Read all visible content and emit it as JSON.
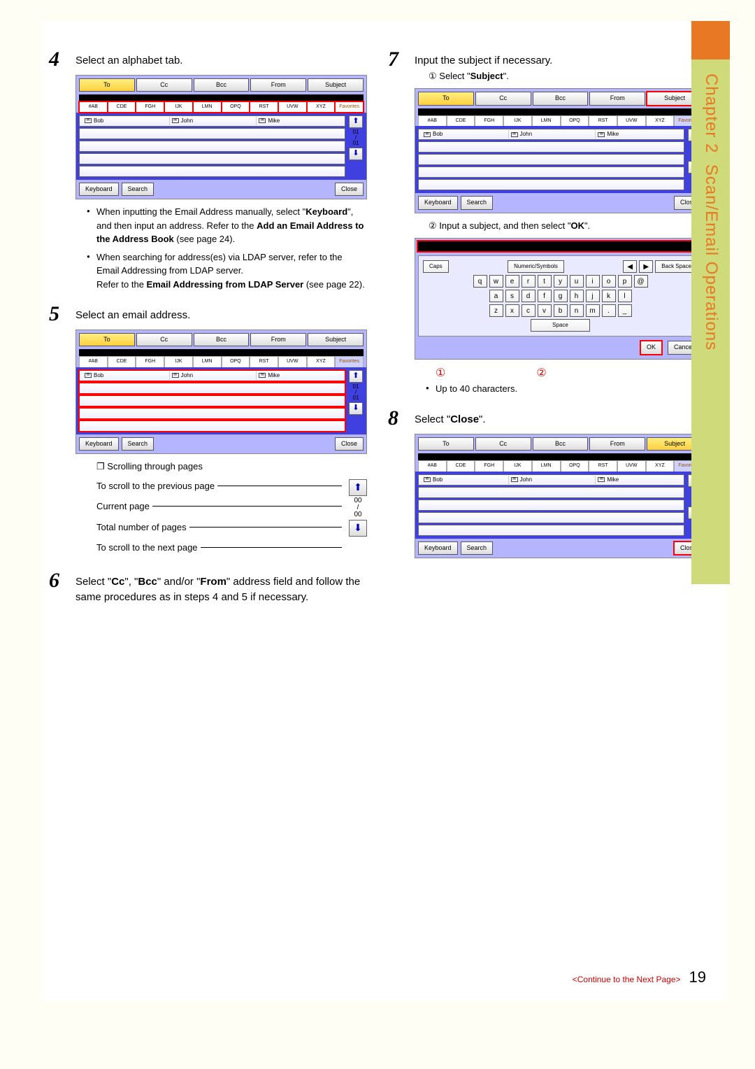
{
  "side": {
    "chapter": "Chapter 2",
    "title": "Scan/Email Operations"
  },
  "step4": {
    "num": "4",
    "text": "Select an alphabet tab.",
    "tabs": [
      "To",
      "Cc",
      "Bcc",
      "From",
      "Subject"
    ],
    "ftabs": [
      "#AB",
      "CDE",
      "FGH",
      "IJK",
      "LMN",
      "OPQ",
      "RST",
      "UVW",
      "XYZ",
      "Favorites"
    ],
    "rows": [
      "Bob",
      "John",
      "Mike"
    ],
    "page": "01",
    "total": "01",
    "btns": {
      "kb": "Keyboard",
      "search": "Search",
      "close": "Close"
    },
    "bullets": [
      {
        "pre": "When inputting the Email Address manually, select \"",
        "b1": "Keyboard",
        "mid": "\", and then input an address. Refer to the ",
        "b2": "Add an Email Address to the Address Book",
        "post": " (see page 24)."
      },
      {
        "pre": "When searching for address(es) via LDAP server, refer to the Email Addressing from LDAP server.",
        "br": "Refer to the ",
        "b2": "Email Addressing from LDAP Server",
        "post": " (see page 22)."
      }
    ]
  },
  "step5": {
    "num": "5",
    "text": "Select an email address.",
    "scroll_label": "Scrolling through pages",
    "sd": {
      "prev": "To scroll to the previous page",
      "cur": "Current page",
      "tot": "Total number of pages",
      "next": "To scroll to the next page",
      "num": "00"
    }
  },
  "step6": {
    "num": "6",
    "pre": "Select \"",
    "b1": "Cc",
    "m1": "\", \"",
    "b2": "Bcc",
    "m2": "\" and/or \"",
    "b3": "From",
    "post": "\" address field and follow the same procedures as in steps 4 and 5 if necessary."
  },
  "step7": {
    "num": "7",
    "text": "Input the subject if necessary.",
    "sub1_pre": "Select \"",
    "sub1_b": "Subject",
    "sub1_post": "\".",
    "sub2_pre": "Input a subject, and then select \"",
    "sub2_b": "OK",
    "sub2_post": "\".",
    "kbd": {
      "caps": "Caps",
      "numsym": "Numeric/Symbols",
      "back": "Back Space",
      "r1": [
        "q",
        "w",
        "e",
        "r",
        "t",
        "y",
        "u",
        "i",
        "o",
        "p",
        "@"
      ],
      "r2": [
        "a",
        "s",
        "d",
        "f",
        "g",
        "h",
        "j",
        "k",
        "l"
      ],
      "r3": [
        "z",
        "x",
        "c",
        "v",
        "b",
        "n",
        "m",
        ".",
        "_"
      ],
      "space": "Space",
      "ok": "OK",
      "cancel": "Cancel"
    },
    "ind1": "①",
    "ind2": "②",
    "upto": "Up to 40 characters."
  },
  "step8": {
    "num": "8",
    "pre": "Select \"",
    "b": "Close",
    "post": "\"."
  },
  "footer": {
    "cont": "<Continue to the Next Page>",
    "page": "19"
  }
}
